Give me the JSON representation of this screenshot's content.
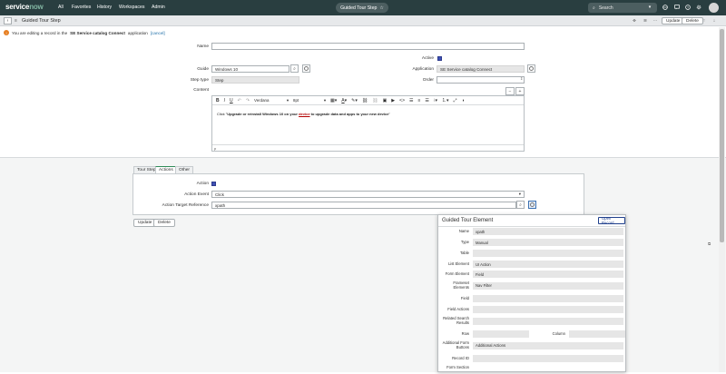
{
  "nav": {
    "logo_service": "service",
    "logo_now": "now",
    "links": [
      "All",
      "Favorites",
      "History",
      "Workspaces",
      "Admin"
    ],
    "context_title": "Guided Tour Step",
    "search_placeholder": "Search"
  },
  "form_header": {
    "title": "Guided Tour Step",
    "update_label": "Update",
    "delete_label": "Delete"
  },
  "info": {
    "icon_text": "!",
    "pre": "You are editing a record in the",
    "app_name": "SE Service catalog Connect",
    "post": "application",
    "cancel": "[cancel]"
  },
  "fields": {
    "name_label": "Name",
    "name_value": "",
    "active_label": "Active",
    "guide_label": "Guide",
    "guide_value": "Windows 10",
    "application_label": "Application",
    "application_value": "SE Service catalog Connect",
    "step_type_label": "Step type",
    "step_type_value": "Step",
    "order_label": "Order",
    "order_value": "",
    "content_label": "Content"
  },
  "editor": {
    "font_name": "Verdana",
    "font_size": "8pt",
    "content_prefix": "Click \"",
    "content_bold_1": "Upgrade or reinstall Windows 10 on your",
    "content_link": "device",
    "content_bold_2": " to ",
    "content_bold_3": "upgrade data and apps to your new device",
    "content_suffix": "\"",
    "footer_text": "p"
  },
  "tabs": [
    {
      "label": "Tour Step",
      "active": false
    },
    {
      "label": "Actions",
      "active": true
    },
    {
      "label": "Other",
      "active": false
    }
  ],
  "actions": {
    "action_label": "Action",
    "action_event_label": "Action Event",
    "action_event_value": "Click",
    "target_label": "Action Target Reference",
    "target_value": "xpath"
  },
  "bottom_buttons": {
    "update": "Update",
    "delete": "Delete"
  },
  "popup": {
    "title": "Guided Tour Element",
    "open_record": "Open Record",
    "rows": [
      {
        "label": "Name",
        "value": ""
      },
      {
        "label": "Type",
        "value": "Manual"
      },
      {
        "label": "Table",
        "value": ""
      },
      {
        "label": "List Element",
        "value": "UI Action"
      },
      {
        "label": "Form Element",
        "value": "Field"
      },
      {
        "label": "Frameset Elements",
        "value": "Nav Filter"
      },
      {
        "label": "Field",
        "value": ""
      },
      {
        "label": "Field Actions",
        "value": ""
      },
      {
        "label": "Related Search Results",
        "value": ""
      }
    ],
    "name_value": "xpath",
    "row_label": "Row",
    "row_value": "",
    "column_label": "Column",
    "column_value": "",
    "additional_form_buttons_label": "Additional Form Buttons",
    "additional_form_buttons_value": "Additional Actions",
    "record_id_label": "Record ID",
    "record_id_value": "",
    "form_section_label": "Form Section"
  }
}
